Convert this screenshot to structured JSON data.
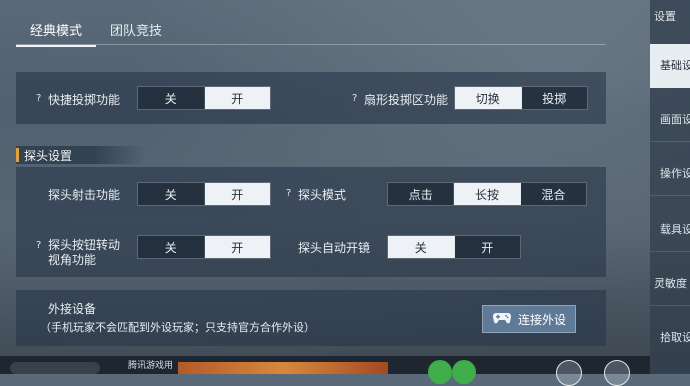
{
  "tabs": [
    {
      "label": "经典模式",
      "active": true
    },
    {
      "label": "团队竞技",
      "active": false
    }
  ],
  "quick_panel": {
    "quick_throw": {
      "label": "快捷投掷功能",
      "help": "?",
      "options": [
        "关",
        "开"
      ],
      "selected": "开"
    },
    "fan_throw": {
      "label": "扇形投掷区功能",
      "help": "?",
      "options": [
        "切换",
        "投掷"
      ],
      "selected": "切换"
    }
  },
  "peek_section": {
    "title": "探头设置",
    "peek_fire": {
      "label": "探头射击功能",
      "options": [
        "关",
        "开"
      ],
      "selected": "开"
    },
    "peek_mode": {
      "label": "探头模式",
      "help": "?",
      "options": [
        "点击",
        "长按",
        "混合"
      ],
      "selected": "长按"
    },
    "peek_rotate": {
      "label_line1": "探头按钮转动",
      "label_line2": "视角功能",
      "help": "?",
      "options": [
        "关",
        "开"
      ],
      "selected": "开"
    },
    "peek_auto_scope": {
      "label": "探头自动开镜",
      "options": [
        "关",
        "开"
      ],
      "selected": "关"
    }
  },
  "external": {
    "title": "外接设备",
    "note": "（手机玩家不会匹配到外设玩家；只支持官方合作外设）",
    "button_label": "连接外设",
    "button_icon": "gamepad-icon"
  },
  "sidebar": {
    "header": "设置",
    "items": [
      {
        "label": "基础设",
        "active": true
      },
      {
        "label": "画面设",
        "active": false
      },
      {
        "label": "操作设",
        "active": false
      },
      {
        "label": "载具设",
        "active": false
      },
      {
        "label": "灵敏度",
        "active": false
      },
      {
        "label": "拾取设",
        "active": false
      }
    ]
  },
  "footer": {
    "text": "腾讯游戏用"
  },
  "colors": {
    "accent": "#e2a23a",
    "selected_bg": "#eef2f6",
    "button_bg": "#5f7a96"
  }
}
